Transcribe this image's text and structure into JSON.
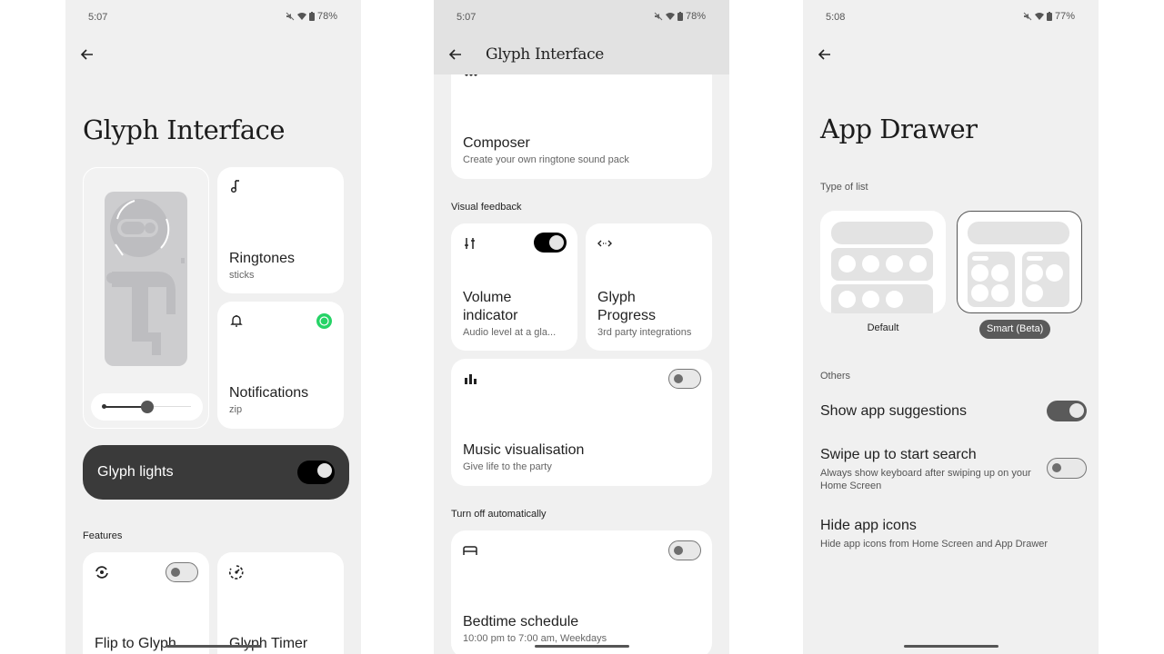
{
  "screens": [
    {
      "status": {
        "time": "5:07",
        "battery": "78%"
      },
      "title": "Glyph Interface",
      "hero": {
        "slider_value": 0.5
      },
      "ringtones": {
        "title": "Ringtones",
        "subtitle": "sticks",
        "icon": "music-note-icon"
      },
      "notifications": {
        "title": "Notifications",
        "subtitle": "zip",
        "icon": "bell-icon",
        "app_badge": "whatsapp-icon"
      },
      "glyph_lights": {
        "label": "Glyph lights",
        "enabled": true
      },
      "features_label": "Features",
      "features": [
        {
          "title": "Flip to Glyph",
          "icon": "flip-icon",
          "enabled": false
        },
        {
          "title": "Glyph Timer",
          "icon": "timer-icon"
        }
      ]
    },
    {
      "status": {
        "time": "5:07",
        "battery": "78%"
      },
      "appbar_title": "Glyph Interface",
      "composer": {
        "title": "Composer",
        "subtitle": "Create your own ringtone sound pack",
        "icon": "dots-icon"
      },
      "visual_feedback_label": "Visual feedback",
      "volume": {
        "title_line1": "Volume",
        "title_line2": "indicator",
        "subtitle": "Audio level at a gla...",
        "icon": "sliders-icon",
        "enabled": true
      },
      "progress": {
        "title_line1": "Glyph",
        "title_line2": "Progress",
        "subtitle": "3rd party integrations",
        "icon": "code-arrows-icon"
      },
      "music": {
        "title": "Music visualisation",
        "subtitle": "Give life to the party",
        "icon": "bar-chart-icon",
        "enabled": false
      },
      "turn_off_label": "Turn off automatically",
      "bedtime": {
        "title": "Bedtime schedule",
        "subtitle": "10:00 pm to 7:00 am, Weekdays",
        "icon": "bed-icon",
        "enabled": false
      }
    },
    {
      "status": {
        "time": "5:08",
        "battery": "77%"
      },
      "title": "App Drawer",
      "type_of_list_label": "Type of list",
      "list_types": [
        {
          "label": "Default",
          "selected": false
        },
        {
          "label": "Smart (Beta)",
          "selected": true
        }
      ],
      "others_label": "Others",
      "settings": [
        {
          "title": "Show app suggestions",
          "enabled": true
        },
        {
          "title": "Swipe up to start search",
          "subtitle": "Always show keyboard after swiping up on your Home Screen",
          "enabled": false
        },
        {
          "title": "Hide app icons",
          "subtitle": "Hide app icons from Home Screen and App Drawer"
        }
      ]
    }
  ],
  "colors": {
    "screen_bg": "#f0f0f0",
    "card_bg": "#ffffff",
    "dark_card": "#3a3a3a",
    "whatsapp_green": "#25d366"
  }
}
